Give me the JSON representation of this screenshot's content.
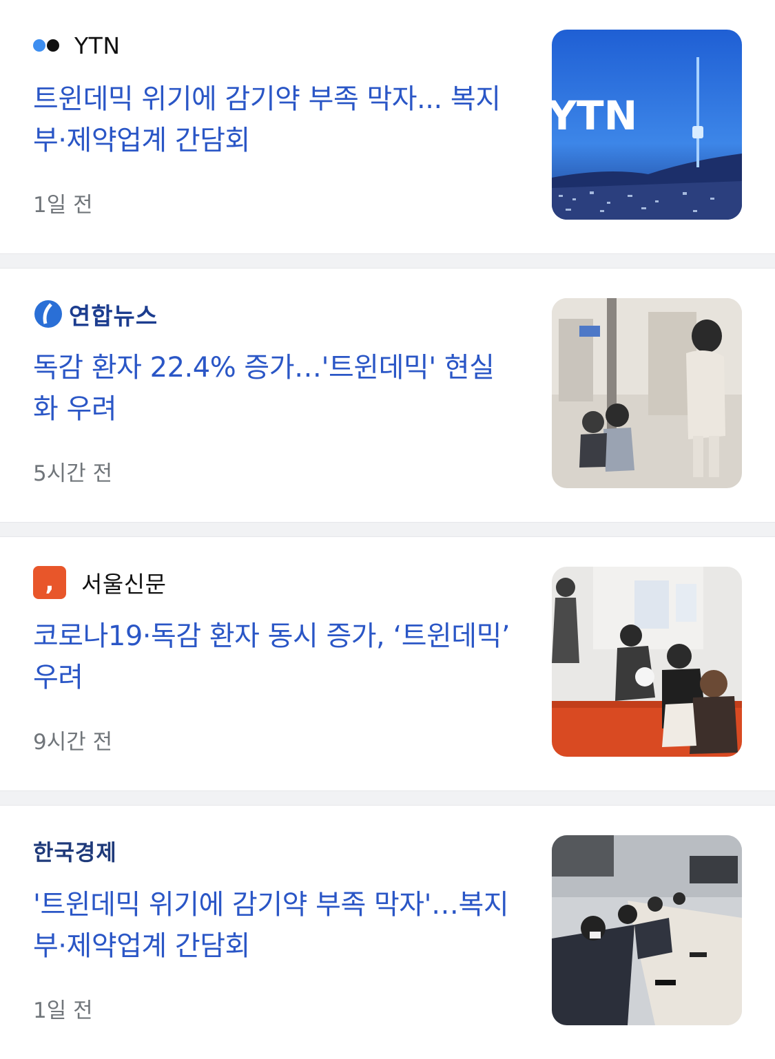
{
  "articles": [
    {
      "source": "YTN",
      "headline": "트윈데믹 위기에 감기약 부족 막자... 복지부·제약업계 간담회",
      "time": "1일 전",
      "thumb_text": "YTN",
      "colors": {
        "dot1": "#3d8ef0",
        "dot2": "#111111"
      }
    },
    {
      "source": "연합뉴스",
      "headline": "독감 환자 22.4% 증가…'트윈데믹' 현실화 우려",
      "time": "5시간 전"
    },
    {
      "source": "서울신문",
      "headline": "코로나19·독감 환자 동시 증가, ‘트윈데믹’ 우려",
      "time": "9시간 전",
      "logo_glyph": ","
    },
    {
      "source": "한국경제",
      "headline": "'트윈데믹 위기에 감기약 부족 막자'…복지부·제약업계 간담회",
      "time": "1일 전"
    }
  ],
  "colors": {
    "headline": "#2a56c6",
    "time": "#70757a",
    "separator": "#f1f2f4"
  }
}
